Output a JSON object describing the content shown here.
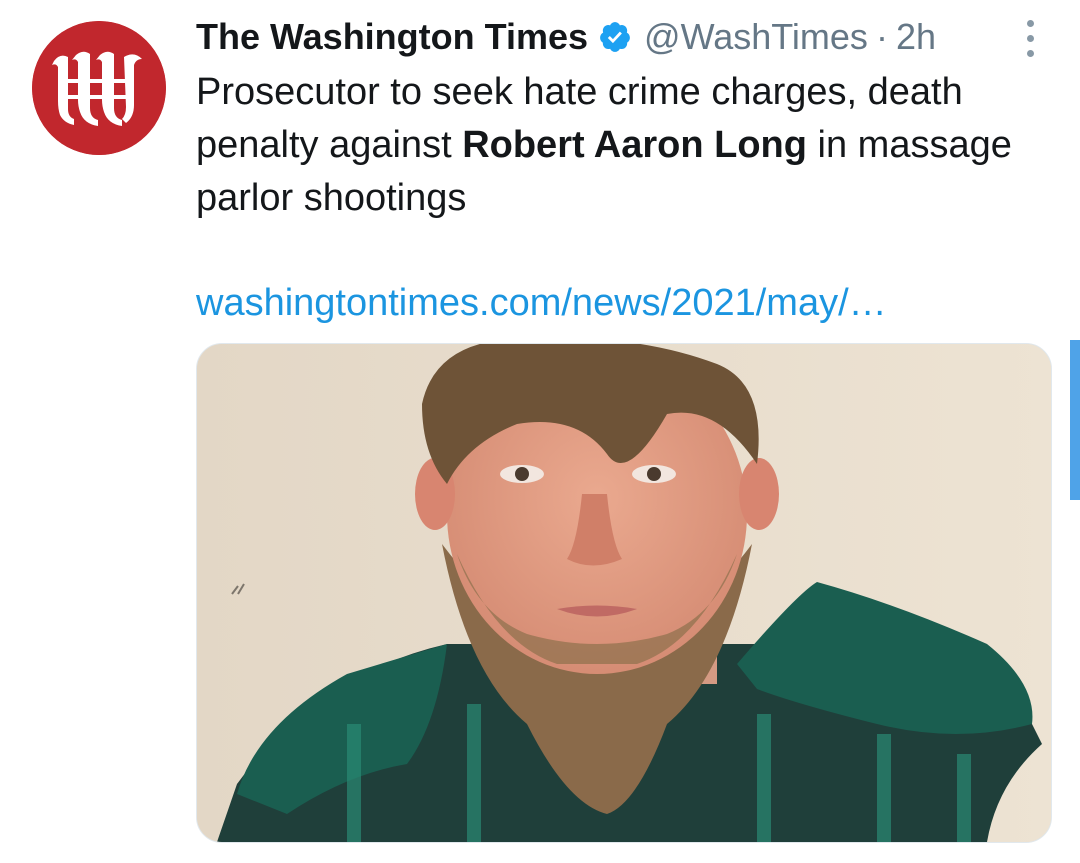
{
  "tweet": {
    "display_name": "The Washington Times",
    "handle": "@WashTimes",
    "separator": "·",
    "time": "2h",
    "text_before": "Prosecutor to seek hate crime charges, death penalty against ",
    "text_bold": "Robert Aaron Long",
    "text_after": " in massage parlor shootings",
    "link": "washingtontimes.com/news/2021/may/…"
  },
  "icons": {
    "avatar": "washington-times-logo",
    "verified": "verified-badge-icon",
    "more": "more-vertical-icon"
  },
  "colors": {
    "brand_red": "#c1272d",
    "link_blue": "#1b95e0",
    "verified_blue": "#1da1f2",
    "muted": "#657786"
  }
}
